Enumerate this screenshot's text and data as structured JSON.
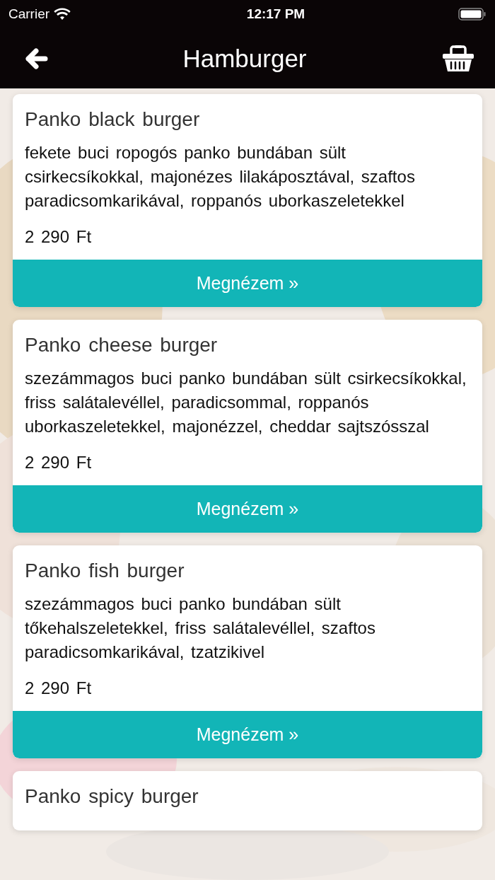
{
  "status_bar": {
    "carrier": "Carrier",
    "time": "12:17 PM"
  },
  "nav_bar": {
    "title": "Hamburger"
  },
  "products": [
    {
      "name": "Panko black burger",
      "description": "fekete buci ropogós panko bundában sült csirkecsíkokkal, majonézes lilakáposztával, szaftos paradicsomkarikával, roppanós uborkaszeletekkel",
      "price": "2 290 Ft",
      "button": "Megnézem »"
    },
    {
      "name": "Panko cheese burger",
      "description": "szezámmagos buci panko bundában sült csirkecsíkokkal, friss salátalevéllel, paradicsommal, roppanós uborkaszeletekkel, majonézzel, cheddar sajtszósszal",
      "price": "2 290 Ft",
      "button": "Megnézem »"
    },
    {
      "name": "Panko fish burger",
      "description": "szezámmagos buci panko bundában sült tőkehalszeletekkel, friss salátalevéllel, szaftos paradicsomkarikával, tzatzikivel",
      "price": "2 290 Ft",
      "button": "Megnézem »"
    },
    {
      "name": "Panko spicy burger"
    }
  ]
}
